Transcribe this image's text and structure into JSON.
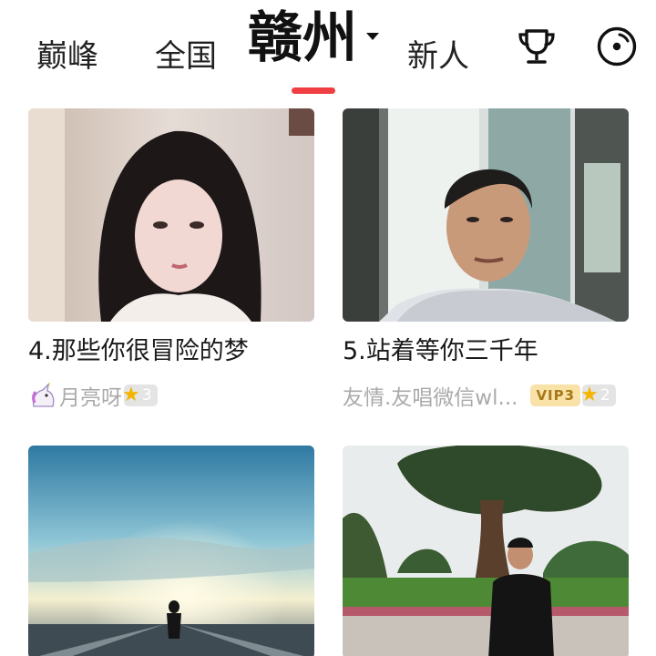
{
  "tabs": {
    "peak": "巅峰",
    "country": "全国",
    "city": "赣州",
    "newbie": "新人"
  },
  "icons": {
    "trophy": "trophy-icon",
    "record": "record-disc-icon",
    "dropdown": "caret-down-icon"
  },
  "colors": {
    "accent": "#ef3f43",
    "star": "#f4b400",
    "vip_bg": "#f8e2a8",
    "vip_text": "#a87918",
    "muted": "#aaaaaa"
  },
  "cards": [
    {
      "title": "4.那些你很冒险的梦",
      "author": "月亮呀",
      "author_icon": "unicorn-emoji",
      "vip": "",
      "level": "3"
    },
    {
      "title": "5.站着等你三千年",
      "author": "友情.友唱微信wl...",
      "author_icon": "",
      "vip": "VIP3",
      "level": "2"
    },
    {
      "title": "",
      "author": "",
      "vip": "",
      "level": ""
    },
    {
      "title": "",
      "author": "",
      "vip": "",
      "level": ""
    }
  ]
}
